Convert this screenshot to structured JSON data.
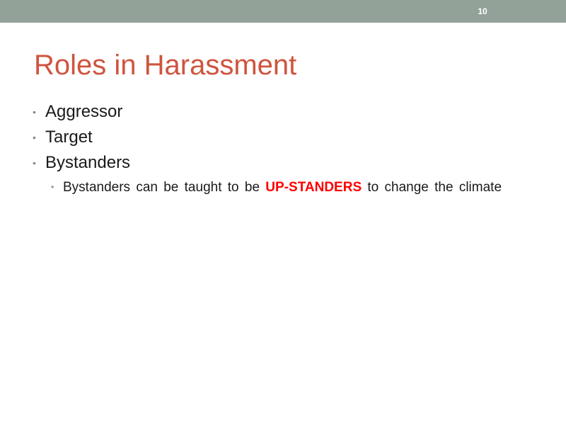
{
  "slide_number": "10",
  "title": "Roles in Harassment",
  "bullets": [
    {
      "text": "Aggressor"
    },
    {
      "text": "Target"
    },
    {
      "text": "Bystanders"
    }
  ],
  "sub_bullet": {
    "before": "Bystanders can be taught to be ",
    "highlight": "UP-STANDERS",
    "after": " to change the climate"
  },
  "colors": {
    "top_bar": "#93a299",
    "title": "#cf543f",
    "highlight": "#ff0000",
    "bullet_marker": "#8c8c8c"
  }
}
